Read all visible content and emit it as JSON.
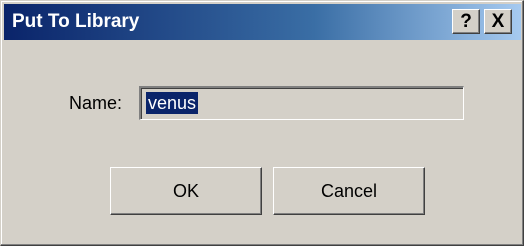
{
  "window": {
    "title": "Put To Library",
    "help_label": "?",
    "close_label": "X"
  },
  "form": {
    "name_label": "Name:",
    "name_value": "venus"
  },
  "buttons": {
    "ok_label": "OK",
    "cancel_label": "Cancel"
  },
  "colors": {
    "titlebar_start": "#0a246a",
    "titlebar_end": "#a6caf0",
    "dialog_face": "#d4d0c8",
    "selection": "#0a246a"
  }
}
